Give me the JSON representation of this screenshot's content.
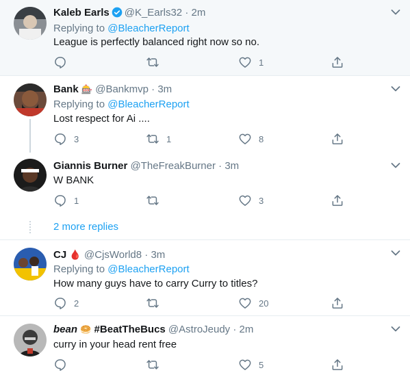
{
  "tweets": [
    {
      "name": "Kaleb Earls",
      "verified": true,
      "handle": "@K_Earls32",
      "time": "2m",
      "replying_prefix": "Replying to",
      "replying_to": "@BleacherReport",
      "text": "League is perfectly balanced right now so no.",
      "replies": "",
      "retweets": "",
      "likes": "1"
    },
    {
      "name": "Bank",
      "emoji": "🎰",
      "handle": "@Bankmvp",
      "time": "3m",
      "replying_prefix": "Replying to",
      "replying_to": "@BleacherReport",
      "text": "Lost respect for Ai ....",
      "replies": "3",
      "retweets": "1",
      "likes": "8"
    },
    {
      "name": "Giannis Burner",
      "handle": "@TheFreakBurner",
      "time": "3m",
      "text": "W BANK",
      "replies": "1",
      "retweets": "",
      "likes": "3"
    },
    {
      "name": "CJ",
      "emoji": "🩸",
      "handle": "@CjsWorld8",
      "time": "3m",
      "replying_prefix": "Replying to",
      "replying_to": "@BleacherReport",
      "text": "How many guys have to carry Curry to titles?",
      "replies": "2",
      "retweets": "",
      "likes": "20"
    },
    {
      "name": "bean",
      "emoji": "🥯",
      "name_extra": "#BeatTheBucs",
      "handle": "@AstroJeudy",
      "time": "2m",
      "text": "curry in your head rent free",
      "replies": "",
      "retweets": "",
      "likes": "5"
    }
  ],
  "more_replies": "2 more replies",
  "separator": "·",
  "colors": {
    "link": "#1da1f2",
    "muted": "#657786",
    "text": "#14171a",
    "highlight_bg": "#f5f8fa",
    "thread_line": "#ccd6dd"
  },
  "icons": [
    "reply-icon",
    "retweet-icon",
    "like-icon",
    "share-icon",
    "chevron-down-icon",
    "verified-badge-icon"
  ]
}
